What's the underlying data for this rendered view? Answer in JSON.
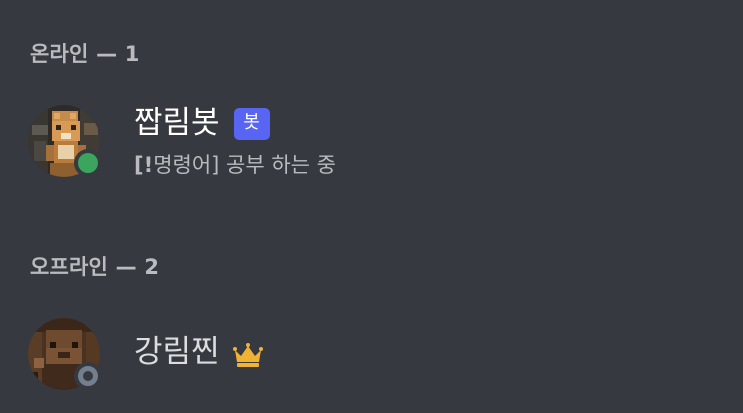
{
  "sections": {
    "online": {
      "label": "온라인",
      "count": "1",
      "separator": "—"
    },
    "offline": {
      "label": "오프라인",
      "count": "2",
      "separator": "—"
    }
  },
  "members": [
    {
      "name": "짭림봇",
      "badge": "봇",
      "status": "online",
      "activity_prefix": "[!",
      "activity_rest": "명령어] 공부 하는 중",
      "avatar_icon": "pixel-fox-avatar"
    },
    {
      "name": "강림찐",
      "status": "offline",
      "owner_icon": "crown-icon",
      "avatar_icon": "pixel-character-avatar"
    }
  ],
  "colors": {
    "background": "#36393f",
    "online": "#3ba55d",
    "offline": "#747f8d",
    "bot_tag": "#5865f2",
    "crown": "#f0b232"
  }
}
